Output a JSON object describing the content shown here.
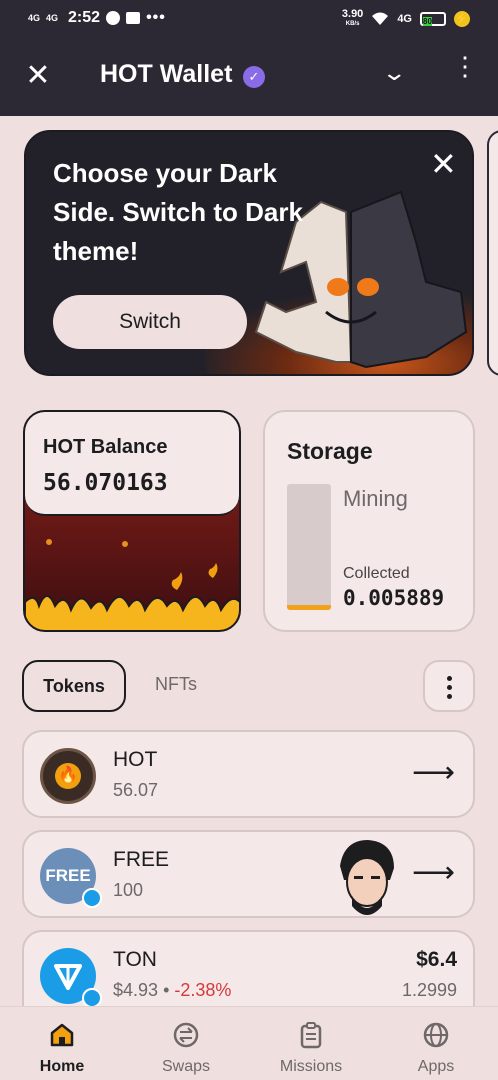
{
  "status_bar": {
    "signal_1": "4G",
    "signal_2": "4G",
    "time": "2:52",
    "more": "•••",
    "speed": "3.90",
    "speed_unit": "KB/s",
    "network": "4G",
    "battery": "80"
  },
  "header": {
    "title": "HOT Wallet",
    "verified_icon": "verified-check-icon"
  },
  "banner": {
    "text": "Choose your Dark Side. Switch to Dark theme!",
    "button_label": "Switch",
    "close_label": "✕"
  },
  "balance": {
    "label": "HOT Balance",
    "value": "56.070163"
  },
  "storage": {
    "title": "Storage",
    "status": "Mining",
    "collected_label": "Collected",
    "collected_value": "0.005889",
    "fill_fraction": 0.04
  },
  "tabs": {
    "tokens": "Tokens",
    "nfts": "NFTs"
  },
  "tokens": [
    {
      "name": "HOT",
      "amount": "56.07"
    },
    {
      "name": "FREE",
      "amount": "100",
      "icon_text": "FREE"
    },
    {
      "name": "TON",
      "price": "$4.93",
      "separator": "•",
      "change": "-2.38%",
      "value": "$6.4",
      "amount": "1.2999"
    }
  ],
  "nav": {
    "home": "Home",
    "swaps": "Swaps",
    "missions": "Missions",
    "apps": "Apps"
  },
  "colors": {
    "accent_dark": "#2c2935",
    "background": "#efe0df",
    "card": "#f4e9e8",
    "hot_orange": "#f2a010",
    "negative": "#d43a3a",
    "ton_blue": "#1b9ce6",
    "verified_purple": "#8a6be8"
  }
}
